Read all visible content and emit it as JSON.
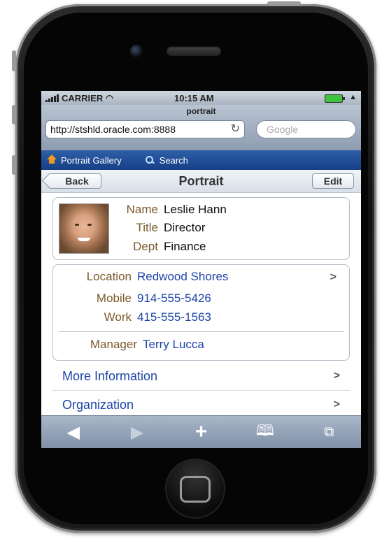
{
  "status": {
    "carrier": "CARRIER",
    "time": "10:15 AM"
  },
  "browser": {
    "page_title": "portrait",
    "url": "http://stshld.oracle.com:8888",
    "search_placeholder": "Google"
  },
  "nav": {
    "gallery": "Portrait Gallery",
    "search": "Search"
  },
  "header": {
    "back": "Back",
    "title": "Portrait",
    "edit": "Edit"
  },
  "profile": {
    "name_label": "Name",
    "name": "Leslie Hann",
    "title_label": "Title",
    "title": "Director",
    "dept_label": "Dept",
    "dept": "Finance"
  },
  "contact": {
    "location_label": "Location",
    "location": "Redwood Shores",
    "mobile_label": "Mobile",
    "mobile": "914-555-5426",
    "work_label": "Work",
    "work": "415-555-1563",
    "manager_label": "Manager",
    "manager": "Terry Lucca"
  },
  "list": {
    "more_info": "More Information",
    "organization": "Organization"
  },
  "colors": {
    "nav_blue": "#1f4e96",
    "link_blue": "#1f45a8",
    "label_brown": "#7a5a2a",
    "accent_orange": "#f29a20"
  },
  "icons": [
    "wifi-icon",
    "battery-icon",
    "reload-icon",
    "home-icon",
    "search-icon",
    "back-arrow-icon",
    "forward-arrow-icon",
    "add-icon",
    "bookmarks-icon",
    "tabs-icon"
  ]
}
